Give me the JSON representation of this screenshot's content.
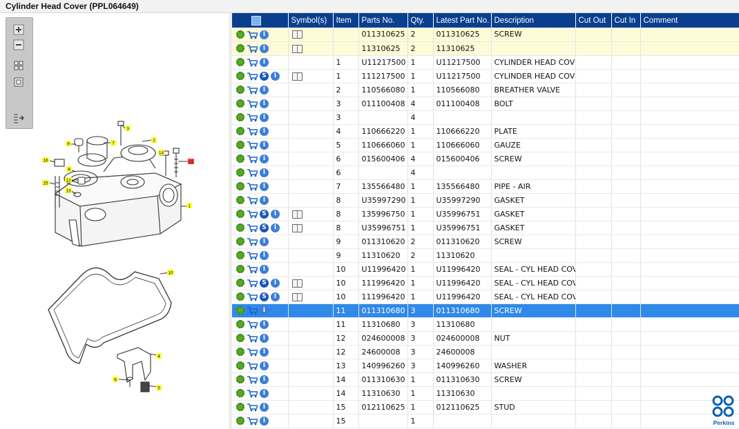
{
  "window": {
    "title": "Cylinder Head Cover (PPL064649)"
  },
  "toolbar": {
    "icons": [
      "zoom-in-icon",
      "zoom-out-icon",
      "fit-grid-icon",
      "actual-size-icon",
      "layout-toggle-icon"
    ]
  },
  "diagram": {
    "callouts": [
      "3",
      "2",
      "9",
      "7",
      "14",
      "11",
      "16",
      "8",
      "12",
      "15",
      "13",
      "1",
      "10",
      "4",
      "6",
      "5"
    ]
  },
  "brand": {
    "name": "Perkins",
    "color": "#0a5fb0"
  },
  "colors": {
    "header_bg": "#0a3f8f",
    "selected_row": "#2f89e8",
    "highlight_row": "#fdfbd8"
  },
  "table": {
    "columns": [
      "",
      "Symbol(s)",
      "Item",
      "Parts No.",
      "Qty.",
      "Latest Part No.",
      "Description",
      "Cut Out",
      "Cut In",
      "Comment"
    ],
    "rows": [
      {
        "icons": "gci",
        "sym": true,
        "item": "",
        "part": "011310625",
        "qty": "2",
        "latest": "011310625",
        "desc": "SCREW",
        "hl": true
      },
      {
        "icons": "gci",
        "sym": true,
        "item": "",
        "part": "11310625",
        "qty": "2",
        "latest": "11310625",
        "desc": "",
        "hl": true
      },
      {
        "icons": "gci",
        "sym": false,
        "item": "1",
        "part": "U11217500",
        "qty": "1",
        "latest": "U11217500",
        "desc": "CYLINDER HEAD COVER"
      },
      {
        "icons": "gcsi",
        "sym": true,
        "item": "1",
        "part": "111217500",
        "qty": "1",
        "latest": "U11217500",
        "desc": "CYLINDER HEAD COVER"
      },
      {
        "icons": "gci",
        "sym": false,
        "item": "2",
        "part": "110566080",
        "qty": "1",
        "latest": "110566080",
        "desc": "BREATHER VALVE"
      },
      {
        "icons": "gci",
        "sym": false,
        "item": "3",
        "part": "011100408",
        "qty": "4",
        "latest": "011100408",
        "desc": "BOLT"
      },
      {
        "icons": "gci",
        "sym": false,
        "item": "3",
        "part": "",
        "qty": "4",
        "latest": "",
        "desc": ""
      },
      {
        "icons": "gci",
        "sym": false,
        "item": "4",
        "part": "110666220",
        "qty": "1",
        "latest": "110666220",
        "desc": "PLATE"
      },
      {
        "icons": "gci",
        "sym": false,
        "item": "5",
        "part": "110666060",
        "qty": "1",
        "latest": "110666060",
        "desc": "GAUZE"
      },
      {
        "icons": "gci",
        "sym": false,
        "item": "6",
        "part": "015600406",
        "qty": "4",
        "latest": "015600406",
        "desc": "SCREW"
      },
      {
        "icons": "gci",
        "sym": false,
        "item": "6",
        "part": "",
        "qty": "4",
        "latest": "",
        "desc": ""
      },
      {
        "icons": "gci",
        "sym": false,
        "item": "7",
        "part": "135566480",
        "qty": "1",
        "latest": "135566480",
        "desc": "PIPE - AIR"
      },
      {
        "icons": "gci",
        "sym": false,
        "item": "8",
        "part": "U35997290",
        "qty": "1",
        "latest": "U35997290",
        "desc": "GASKET"
      },
      {
        "icons": "gcsi",
        "sym": true,
        "item": "8",
        "part": "135996750",
        "qty": "1",
        "latest": "U35996751",
        "desc": "GASKET"
      },
      {
        "icons": "gcsi",
        "sym": true,
        "item": "8",
        "part": "U35996751",
        "qty": "1",
        "latest": "U35996751",
        "desc": "GASKET"
      },
      {
        "icons": "gci",
        "sym": false,
        "item": "9",
        "part": "011310620",
        "qty": "2",
        "latest": "011310620",
        "desc": "SCREW"
      },
      {
        "icons": "gci",
        "sym": false,
        "item": "9",
        "part": "11310620",
        "qty": "2",
        "latest": "11310620",
        "desc": ""
      },
      {
        "icons": "gci",
        "sym": false,
        "item": "10",
        "part": "U11996420",
        "qty": "1",
        "latest": "U11996420",
        "desc": "SEAL - CYL HEAD COVER"
      },
      {
        "icons": "gcsi",
        "sym": true,
        "item": "10",
        "part": "111996420",
        "qty": "1",
        "latest": "U11996420",
        "desc": "SEAL - CYL HEAD COVER"
      },
      {
        "icons": "gcsi",
        "sym": true,
        "item": "10",
        "part": "111996420",
        "qty": "1",
        "latest": "U11996420",
        "desc": "SEAL - CYL HEAD COVER"
      },
      {
        "icons": "gci",
        "sym": false,
        "item": "11",
        "part": "011310680",
        "qty": "3",
        "latest": "011310680",
        "desc": "SCREW",
        "sel": true
      },
      {
        "icons": "gci",
        "sym": false,
        "item": "11",
        "part": "11310680",
        "qty": "3",
        "latest": "11310680",
        "desc": ""
      },
      {
        "icons": "gci",
        "sym": false,
        "item": "12",
        "part": "024600008",
        "qty": "3",
        "latest": "024600008",
        "desc": "NUT"
      },
      {
        "icons": "gci",
        "sym": false,
        "item": "12",
        "part": "24600008",
        "qty": "3",
        "latest": "24600008",
        "desc": ""
      },
      {
        "icons": "gci",
        "sym": false,
        "item": "13",
        "part": "140996260",
        "qty": "3",
        "latest": "140996260",
        "desc": "WASHER"
      },
      {
        "icons": "gci",
        "sym": false,
        "item": "14",
        "part": "011310630",
        "qty": "1",
        "latest": "011310630",
        "desc": "SCREW"
      },
      {
        "icons": "gci",
        "sym": false,
        "item": "14",
        "part": "11310630",
        "qty": "1",
        "latest": "11310630",
        "desc": ""
      },
      {
        "icons": "gci",
        "sym": false,
        "item": "15",
        "part": "012110625",
        "qty": "1",
        "latest": "012110625",
        "desc": "STUD"
      },
      {
        "icons": "gci",
        "sym": false,
        "item": "15",
        "part": "",
        "qty": "1",
        "latest": "",
        "desc": ""
      }
    ]
  }
}
